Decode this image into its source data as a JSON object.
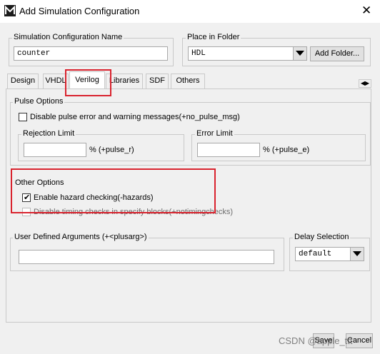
{
  "window": {
    "title": "Add Simulation Configuration",
    "close_glyph": "✕"
  },
  "config_name": {
    "label": "Simulation Configuration Name",
    "value": "counter"
  },
  "place_folder": {
    "label": "Place in Folder",
    "value": "HDL",
    "add_folder_label": "Add Folder..."
  },
  "tabs": [
    {
      "label": "Design"
    },
    {
      "label": "VHDL"
    },
    {
      "label": "Verilog",
      "active": true
    },
    {
      "label": "Libraries"
    },
    {
      "label": "SDF"
    },
    {
      "label": "Others"
    }
  ],
  "pulse_options": {
    "label": "Pulse Options",
    "disable_pulse_label": "Disable pulse error and warning messages(+no_pulse_msg)",
    "disable_pulse_checked": false,
    "rejection": {
      "label": "Rejection Limit",
      "suffix": "% (+pulse_r)",
      "value": ""
    },
    "error": {
      "label": "Error Limit",
      "suffix": "% (+pulse_e)",
      "value": ""
    }
  },
  "other_options": {
    "label": "Other Options",
    "hazard_label": "Enable hazard checking(-hazards)",
    "hazard_checked": true,
    "timing_label": "Disable timing checks in specify blocks(+notimingchecks)",
    "timing_checked": false
  },
  "user_args": {
    "label": "User Defined Arguments (+<plusarg>)",
    "value": ""
  },
  "delay_selection": {
    "label": "Delay Selection",
    "value": "default"
  },
  "footer": {
    "save_label": "Save",
    "cancel_label": "Cancel",
    "watermark": "CSDN @apple_ttt"
  },
  "colors": {
    "annotation_red": "#d9232e"
  }
}
